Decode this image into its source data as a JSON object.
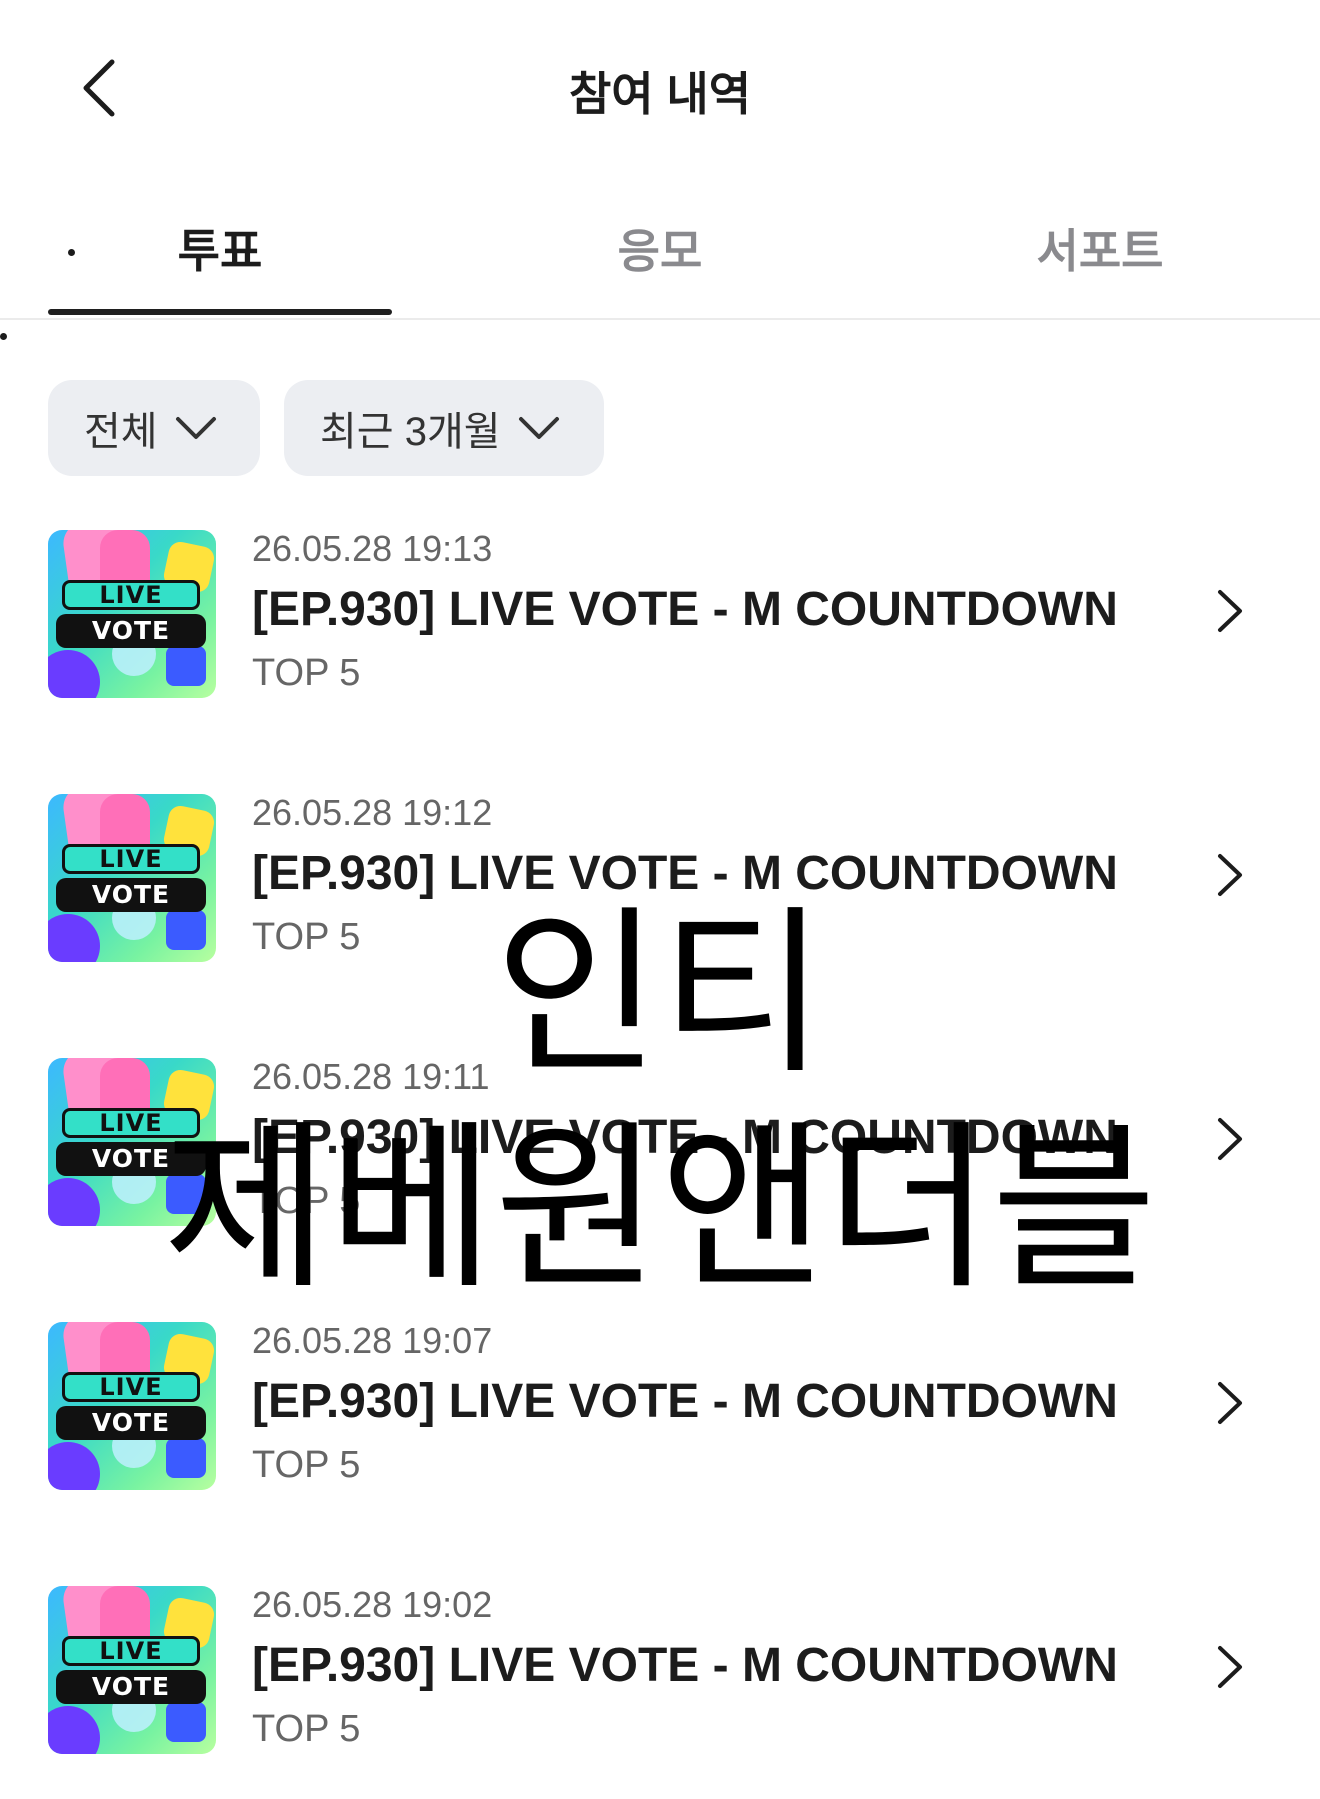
{
  "header": {
    "title": "참여 내역",
    "back_icon": "chevron-left-icon"
  },
  "tabs": [
    {
      "label": "투표",
      "active": true
    },
    {
      "label": "응모",
      "active": false
    },
    {
      "label": "서포트",
      "active": false
    }
  ],
  "filters": {
    "category": "전체",
    "period": "최근 3개월"
  },
  "items": [
    {
      "date": "26.05.28 19:13",
      "title": "[EP.930] LIVE VOTE - M COUNTDOWN",
      "subtitle": "TOP 5",
      "thumb_live": "LIVE",
      "thumb_vote": "VOTE"
    },
    {
      "date": "26.05.28 19:12",
      "title": "[EP.930] LIVE VOTE - M COUNTDOWN",
      "subtitle": "TOP 5",
      "thumb_live": "LIVE",
      "thumb_vote": "VOTE"
    },
    {
      "date": "26.05.28 19:11",
      "title": "[EP.930] LIVE VOTE - M COUNTDOWN",
      "subtitle": "TOP 5",
      "thumb_live": "LIVE",
      "thumb_vote": "VOTE"
    },
    {
      "date": "26.05.28 19:07",
      "title": "[EP.930] LIVE VOTE - M COUNTDOWN",
      "subtitle": "TOP 5",
      "thumb_live": "LIVE",
      "thumb_vote": "VOTE"
    },
    {
      "date": "26.05.28 19:02",
      "title": "[EP.930] LIVE VOTE - M COUNTDOWN",
      "subtitle": "TOP 5",
      "thumb_live": "LIVE",
      "thumb_vote": "VOTE"
    }
  ],
  "watermark": {
    "line1": "인티",
    "line2": "제베원앤더블"
  },
  "colors": {
    "active_text": "#1c1c1c",
    "inactive_text": "#8a8a8e",
    "chip_bg": "#eceef2",
    "meta_text": "#666666"
  }
}
